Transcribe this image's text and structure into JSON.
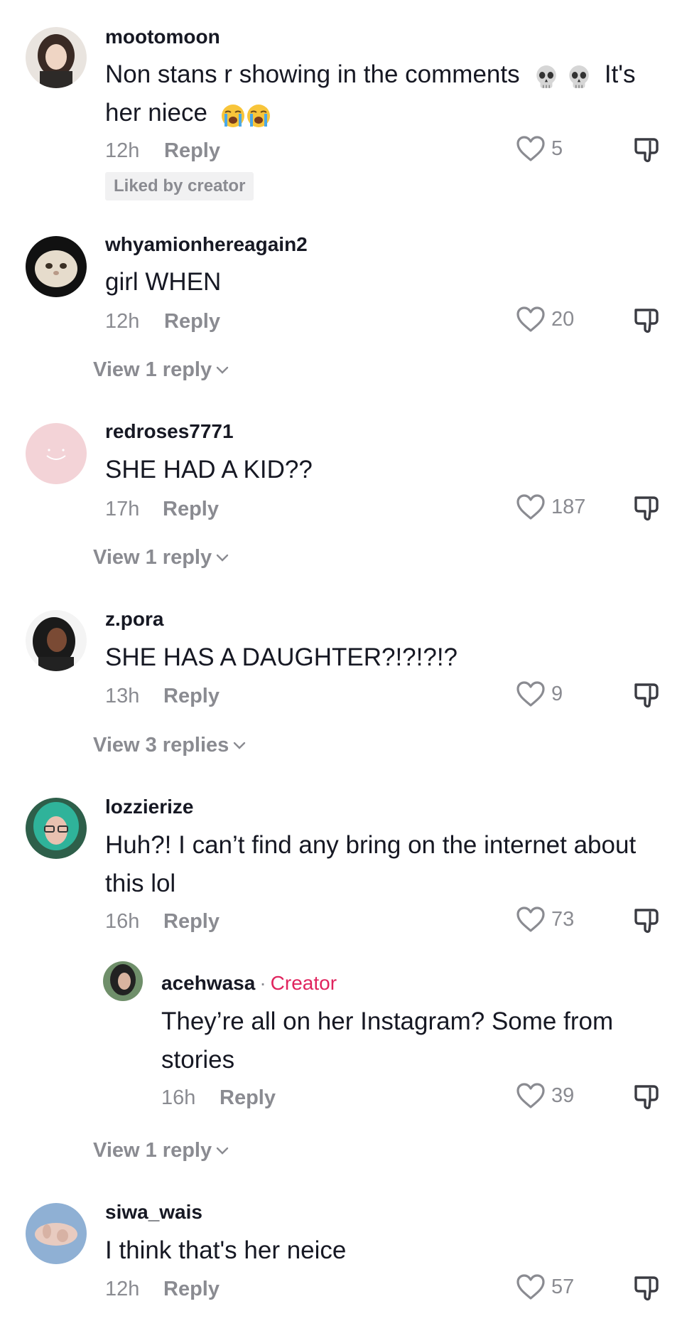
{
  "comments": [
    {
      "username": "mootomoon",
      "text": "Non stans r showing in the comments",
      "text_end": "It's",
      "text_line2": "her niece",
      "time": "12h",
      "reply_label": "Reply",
      "likes": "5",
      "badge": "Liked by creator"
    },
    {
      "username": "whyamionhereagain2",
      "text": "girl WHEN",
      "time": "12h",
      "reply_label": "Reply",
      "likes": "20",
      "view_replies": "View 1 reply"
    },
    {
      "username": "redroses7771",
      "text": "SHE HAD A KID??",
      "time": "17h",
      "reply_label": "Reply",
      "likes": "187",
      "view_replies": "View 1 reply"
    },
    {
      "username": "z.pora",
      "text": "SHE HAS A DAUGHTER?!?!?!?",
      "time": "13h",
      "reply_label": "Reply",
      "likes": "9",
      "view_replies": "View 3 replies"
    },
    {
      "username": "lozzierize",
      "text": "Huh?! I can’t find any bring on the internet about this lol",
      "time": "16h",
      "reply_label": "Reply",
      "likes": "73",
      "reply": {
        "username": "acehwasa",
        "dot": "·",
        "creator_label": "Creator",
        "text": "They’re all on her Instagram? Some from stories",
        "time": "16h",
        "reply_label": "Reply",
        "likes": "39"
      },
      "view_replies": "View 1 reply"
    },
    {
      "username": "siwa_wais",
      "text": "I think that's her neice",
      "time": "12h",
      "reply_label": "Reply",
      "likes": "57"
    }
  ],
  "colors": {
    "text": "#161823",
    "muted": "#8a8b91",
    "creator": "#e0245e",
    "badge_bg": "#f1f1f2"
  },
  "icons": [
    "heart-icon",
    "dislike-icon",
    "chevron-down-icon",
    "skull-emoji",
    "crying-emoji"
  ]
}
